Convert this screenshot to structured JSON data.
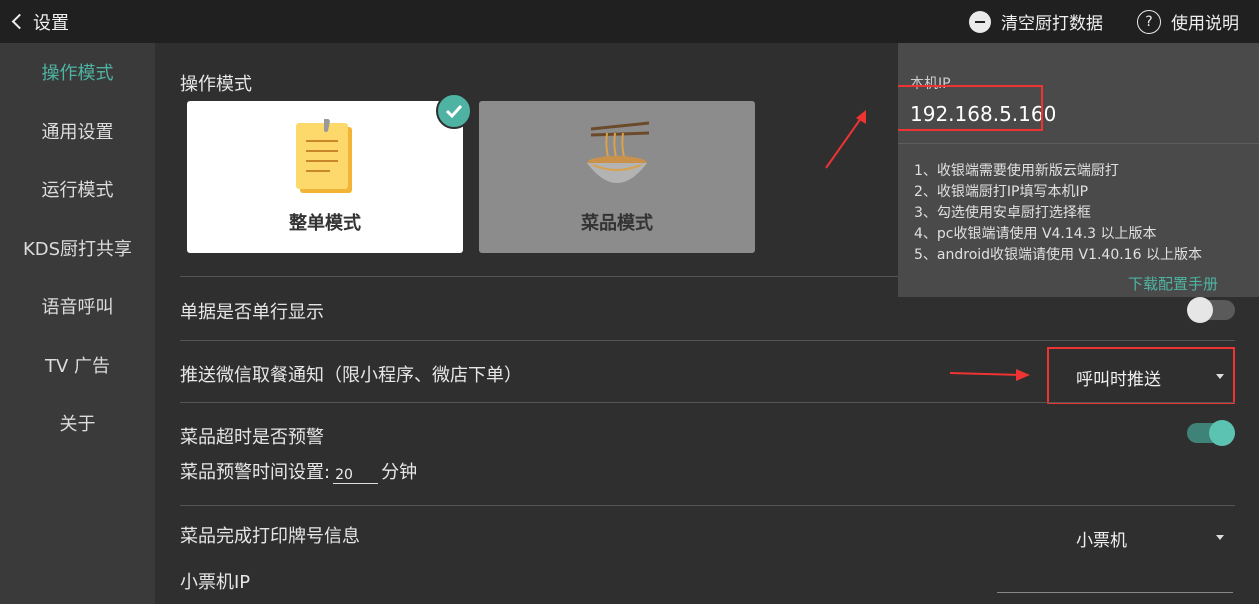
{
  "topbar": {
    "back_title": "设置",
    "clear_label": "清空厨打数据",
    "help_label": "使用说明"
  },
  "sidebar": {
    "items": [
      {
        "label": "操作模式",
        "active": true
      },
      {
        "label": "通用设置"
      },
      {
        "label": "运行模式"
      },
      {
        "label": "KDS厨打共享"
      },
      {
        "label": "语音呼叫"
      },
      {
        "label": "TV 广告"
      },
      {
        "label": "关于"
      }
    ]
  },
  "main": {
    "section_title": "操作模式",
    "modes": [
      {
        "label": "整单模式",
        "selected": true
      },
      {
        "label": "菜品模式",
        "selected": false
      }
    ],
    "single_line": {
      "label": "单据是否单行显示",
      "enabled": false
    },
    "wechat_push": {
      "label": "推送微信取餐通知（限小程序、微店下单）",
      "value": "呼叫时推送"
    },
    "timeout_warning": {
      "label": "菜品超时是否预警",
      "enabled": true
    },
    "warning_time": {
      "label": "菜品预警时间设置:",
      "value": "20",
      "unit": "分钟"
    },
    "print_number": {
      "label": "菜品完成打印牌号信息",
      "value": "小票机"
    },
    "printer_ip": {
      "label": "小票机IP"
    }
  },
  "popup": {
    "ip_label": "本机IP",
    "ip_value": "192.168.5.160",
    "steps": [
      "1、收银端需要使用新版云端厨打",
      "2、收银端厨打IP填写本机IP",
      "3、勾选使用安卓厨打选择框",
      "4、pc收银端请使用 V4.14.3 以上版本",
      "5、android收银端请使用 V1.40.16 以上版本"
    ],
    "link": "下载配置手册"
  },
  "colors": {
    "accent": "#4fb3a3",
    "annotation": "#e33333"
  }
}
